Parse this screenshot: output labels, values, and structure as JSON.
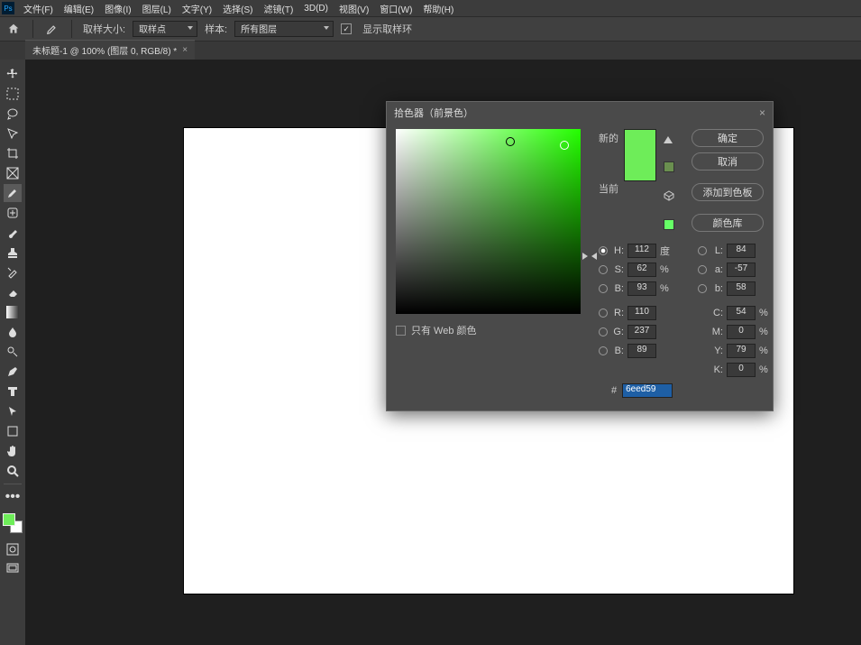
{
  "menubar": {
    "items": [
      "文件(F)",
      "编辑(E)",
      "图像(I)",
      "图层(L)",
      "文字(Y)",
      "选择(S)",
      "滤镜(T)",
      "3D(D)",
      "视图(V)",
      "窗口(W)",
      "帮助(H)"
    ]
  },
  "optsbar": {
    "sample_size_label": "取样大小:",
    "sample_size_value": "取样点",
    "sample_label": "样本:",
    "sample_value": "所有图层",
    "show_ring_label": "显示取样环"
  },
  "tab": {
    "title": "未标题-1 @ 100% (图层 0, RGB/8) *"
  },
  "picker": {
    "title": "拾色器（前景色）",
    "btn_ok": "确定",
    "btn_cancel": "取消",
    "btn_add": "添加到色板",
    "btn_lib": "颜色库",
    "new_label": "新的",
    "cur_label": "当前",
    "web_only": "只有 Web 颜色",
    "new_color": "#6eed59",
    "cur_color": "#6eed59",
    "hue_base": "#24ff00",
    "hue_pct": 69,
    "field_x_pct": 62,
    "field_y_pct": 7,
    "field_cur_x_pct": 91,
    "field_cur_y_pct": 9,
    "H_label": "H:",
    "H_val": "112",
    "H_unit": "度",
    "S_label": "S:",
    "S_val": "62",
    "S_unit": "%",
    "Bm_label": "B:",
    "Bm_val": "93",
    "Bm_unit": "%",
    "L_label": "L:",
    "L_val": "84",
    "a_label": "a:",
    "a_val": "-57",
    "b_label": "b:",
    "b_val": "58",
    "R_label": "R:",
    "R_val": "110",
    "G_label": "G:",
    "G_val": "237",
    "Bl_label": "B:",
    "Bl_val": "89",
    "C_label": "C:",
    "C_val": "54",
    "C_unit": "%",
    "M_label": "M:",
    "M_val": "0",
    "M_unit": "%",
    "Y_label": "Y:",
    "Y_val": "79",
    "Y_unit": "%",
    "K_label": "K:",
    "K_val": "0",
    "K_unit": "%",
    "hash": "#",
    "hex": "6eed59"
  },
  "colors": {
    "fg": "#6eed59",
    "bg": "#ffffff"
  }
}
